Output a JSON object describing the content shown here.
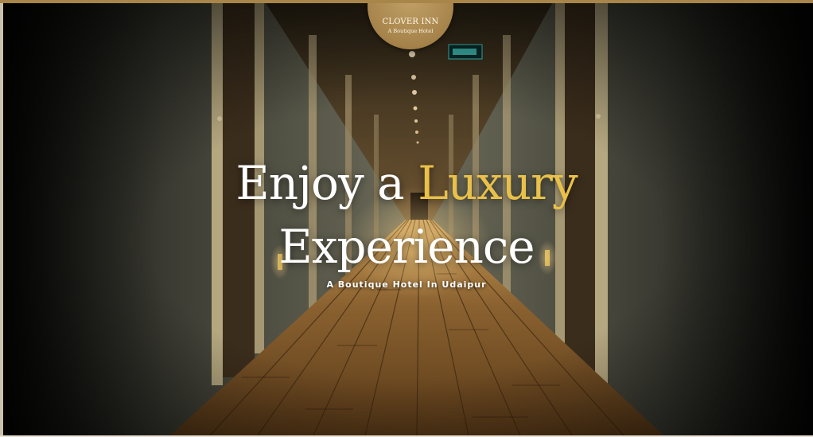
{
  "logo": {
    "name": "CLOVER INN",
    "tagline": "A Boutique Hotel"
  },
  "hero": {
    "headline_part1": "Enjoy a ",
    "headline_accent": "Luxury",
    "headline_line2": "Experience",
    "subtitle": "A Boutique Hotel In Udaipur"
  },
  "colors": {
    "accent_gold": "#e9c14a",
    "logo_gold": "#a8864a",
    "headline": "#ffffff"
  }
}
